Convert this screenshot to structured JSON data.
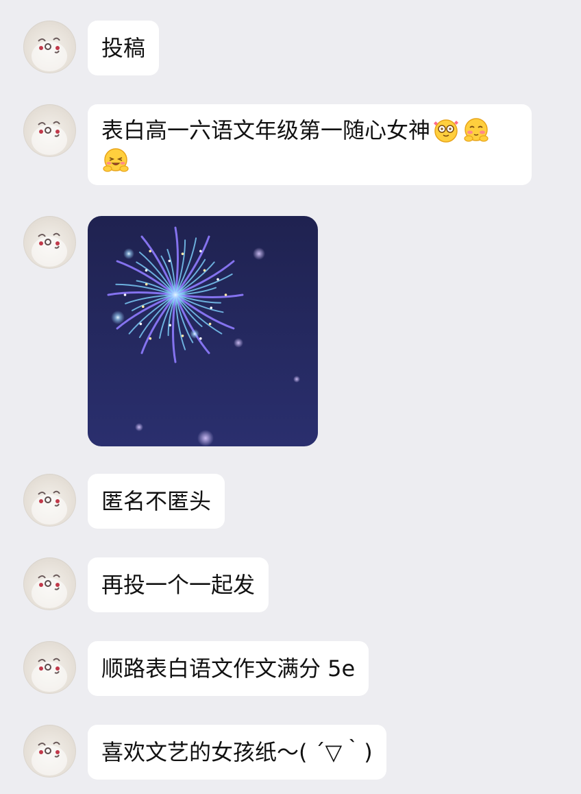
{
  "messages": [
    {
      "type": "text",
      "text": "投稿"
    },
    {
      "type": "text",
      "text": "表白高一六语文年级第一随心女神",
      "emojis": [
        "starry-eyes-emoji",
        "blush-emoji",
        "happy-emoji"
      ]
    },
    {
      "type": "image",
      "image": "fireworks-sticker"
    },
    {
      "type": "text",
      "text": "匿名不匿头"
    },
    {
      "type": "text",
      "text": "再投一个一起发"
    },
    {
      "type": "text",
      "text": "顺路表白语文作文满分 5e"
    },
    {
      "type": "text",
      "text": "喜欢文艺的女孩纸～( ´▽｀)"
    }
  ],
  "colors": {
    "background": "#ededf1",
    "bubble": "#ffffff",
    "text": "#111111",
    "sticker_bg": "#23275a",
    "firework_blue": "#7fd3ff",
    "firework_purple": "#8f7bff"
  }
}
